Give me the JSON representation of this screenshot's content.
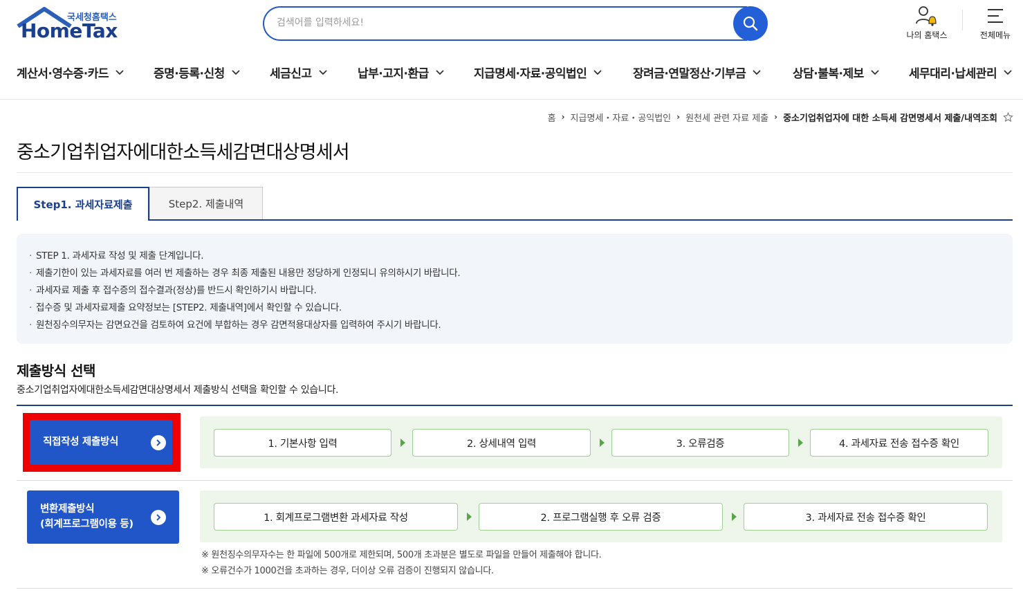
{
  "header": {
    "logo_small": "국세청홈택스",
    "logo_big": "HomeTax",
    "search_placeholder": "검색어를 입력하세요!",
    "my_hometax": "나의 홈택스",
    "all_menu": "전체메뉴"
  },
  "gnb": [
    "계산서·영수증·카드",
    "증명·등록·신청",
    "세금신고",
    "납부·고지·환급",
    "지급명세·자료·공익법인",
    "장려금·연말정산·기부금",
    "상담·불복·제보",
    "세무대리·납세관리"
  ],
  "breadcrumb": [
    "홈",
    "지급명세・자료・공익법인",
    "원천세 관련 자료 제출",
    "중소기업취업자에 대한 소득세 감면명세서 제출/내역조회"
  ],
  "page_title": "중소기업취업자에대한소득세감면대상명세서",
  "tabs": [
    "Step1. 과세자료제출",
    "Step2. 제출내역"
  ],
  "info": [
    "STEP 1. 과세자료 작성 및 제출 단계입니다.",
    "제출기한이 있는 과세자료를 여러 번 제출하는 경우 최종 제출된 내용만 정당하게 인정되니 유의하시기 바랍니다.",
    "과세자료 제출 후 접수증의 접수결과(정상)를 반드시 확인하기시 바랍니다.",
    "접수증 및 과세자료제출 요약정보는 [STEP2. 제출내역]에서 확인할 수 있습니다.",
    "원천징수의무자는 감면요건을 검토하여 요건에 부합하는 경우 감면적용대상자를 입력하여 주시기 바랍니다."
  ],
  "section": {
    "title": "제출방식 선택",
    "desc": "중소기업취업자에대한소득세감면대상명세서 제출방식 선택을 확인할 수 있습니다."
  },
  "method1": {
    "label": "직접작성 제출방식",
    "steps": [
      "1. 기본사항 입력",
      "2. 상세내역 입력",
      "3. 오류검증",
      "4. 과세자료 전송 접수증 확인"
    ]
  },
  "method2": {
    "label_line1": "변환제출방식",
    "label_line2": "(회계프로그램이용 등)",
    "steps": [
      "1. 회계프로그램변환 과세자료 작성",
      "2. 프로그램실행 후 오류 검증",
      "3. 과세자료 전송 접수증 확인"
    ]
  },
  "notes": [
    "※ 원천징수의무자수는 한 파일에 500개로 제한되며, 500개 초과분은 별도로 파일을 만들어 제출해야 합니다.",
    "※ 오류건수가 1000건을 초과하는 경우, 더이상 오류 검증이 진행되지 않습니다."
  ],
  "colors": {
    "primary": "#1a3f8c",
    "button": "#2156c9",
    "highlight": "#ee0000",
    "step_bg": "#eef5ea",
    "step_border": "#9fcf95"
  }
}
